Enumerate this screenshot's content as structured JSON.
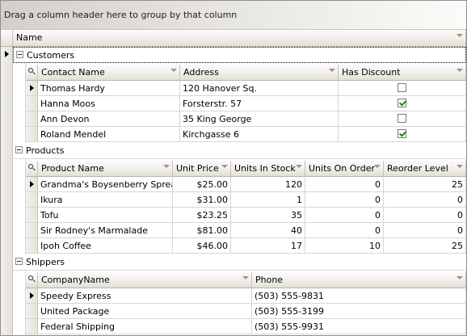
{
  "group_panel": {
    "hint": "Drag a column header here to group by that column"
  },
  "master": {
    "column_header": "Name"
  },
  "bands": {
    "customers": {
      "name": "Customers",
      "columns": [
        "Contact Name",
        "Address",
        "Has Discount"
      ],
      "rows": [
        {
          "contact": "Thomas Hardy",
          "address": "120 Hanover Sq.",
          "discount": false
        },
        {
          "contact": "Hanna Moos",
          "address": "Forsterstr. 57",
          "discount": true
        },
        {
          "contact": "Ann Devon",
          "address": "35 King George",
          "discount": false
        },
        {
          "contact": "Roland Mendel",
          "address": "Kirchgasse 6",
          "discount": true
        }
      ]
    },
    "products": {
      "name": "Products",
      "columns": [
        "Product Name",
        "Unit Price",
        "Units In Stock",
        "Units On Order",
        "Reorder Level"
      ],
      "rows": [
        {
          "name": "Grandma's Boysenberry Spread",
          "price": "$25.00",
          "stock": "120",
          "order": "0",
          "reorder": "25"
        },
        {
          "name": "Ikura",
          "price": "$31.00",
          "stock": "1",
          "order": "0",
          "reorder": "0"
        },
        {
          "name": "Tofu",
          "price": "$23.25",
          "stock": "35",
          "order": "0",
          "reorder": "0"
        },
        {
          "name": "Sir Rodney's Marmalade",
          "price": "$81.00",
          "stock": "40",
          "order": "0",
          "reorder": "0"
        },
        {
          "name": "Ipoh Coffee",
          "price": "$46.00",
          "stock": "17",
          "order": "10",
          "reorder": "25"
        }
      ]
    },
    "shippers": {
      "name": "Shippers",
      "columns": [
        "CompanyName",
        "Phone"
      ],
      "rows": [
        {
          "company": "Speedy Express",
          "phone": "(503) 555-9831"
        },
        {
          "company": "United Package",
          "phone": "(503) 555-3199"
        },
        {
          "company": "Federal Shipping",
          "phone": "(503) 555-9931"
        }
      ]
    }
  },
  "icons": {
    "row_indicator": "triangle-right-icon",
    "expander": "collapse-minus-icon",
    "column_chooser": "search-icon",
    "column_menu": "chevron-down-icon",
    "checkbox_checked": "checkmark-icon"
  },
  "colors": {
    "checkmark": "#1e8a1e",
    "grid_line": "#d6d6d6",
    "header_border": "#b9b5a8"
  }
}
